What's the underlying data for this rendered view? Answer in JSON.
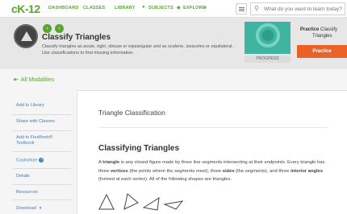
{
  "nav": {
    "logo": "cK-12",
    "dashboard": "DASHBOARD",
    "classes": "CLASSES",
    "library": "LIBRARY",
    "subjects": "SUBJECTS",
    "explore": "EXPLORE",
    "search_placeholder": "What do you want to learn today?"
  },
  "header": {
    "title": "Classify Triangles",
    "description": "Classify triangles as acute, right, obtuse or equiangular and as scalene, isosceles or equilateral. Use classifications to find missing information.",
    "progress_label": "PROGRESS",
    "practice_bold": "Practice",
    "practice_rest": "Classify",
    "practice_sub": "Triangles",
    "practice_button": "Practice"
  },
  "modalities_link": "All Modalities",
  "sidebar": {
    "items": [
      "Add to Library",
      "Share with Classes",
      "Add to FlexBook®",
      "Textbook",
      "Customize",
      "Details",
      "Resources",
      "Download"
    ]
  },
  "content": {
    "section_title": "Triangle Classification",
    "subtitle": "Classifying Triangles",
    "p1": "A ",
    "p_triangle": "triangle",
    "p2": " is any closed figure made by three line segments intersecting at their endpoints. Every triangle has three ",
    "p_vertices": "vertices",
    "p3": " (the points where the segments meet), three ",
    "p_sides": "sides",
    "p4": " (the segments), and three ",
    "p_angles": "interior angles",
    "p5": " (formed at each vertex). All of the following shapes are triangles."
  },
  "colors": {
    "brand_green": "#58a630",
    "practice_orange": "#e8622a",
    "link_blue": "#3f7fbf",
    "thumb_teal": "#3fb4a1"
  }
}
